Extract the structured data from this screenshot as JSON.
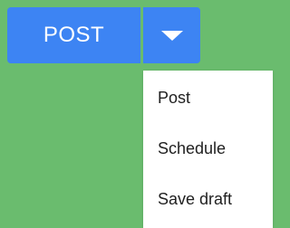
{
  "split_button": {
    "label": "POST",
    "toggle_icon": "caret-down-icon",
    "color": "#3d84f3"
  },
  "menu": {
    "items": [
      {
        "label": "Post"
      },
      {
        "label": "Schedule"
      },
      {
        "label": "Save draft"
      }
    ]
  },
  "background_color": "#6abc6e"
}
